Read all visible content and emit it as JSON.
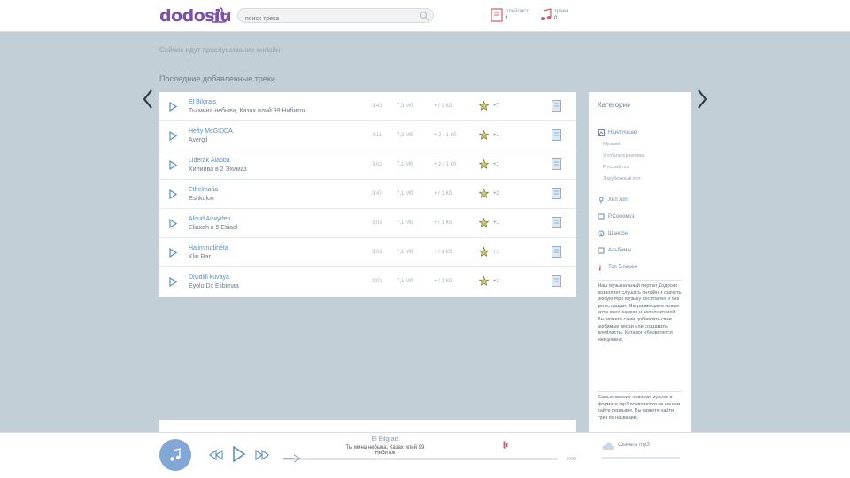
{
  "header": {
    "logo": "dodosiu",
    "search_placeholder": "поиск трека",
    "playlist": {
      "label": "плейлист",
      "count": "1"
    },
    "tracks_counter": {
      "label": "треки",
      "count": "0"
    }
  },
  "ghost_line": "Сейчас идут прослушивание онлайн",
  "section_title": "Последние добавленные треки",
  "tracks": [
    {
      "title": "El Bilgrais",
      "artist": "Ты мина небыва, Казах илий 99 Нибиток",
      "duration": "3:41",
      "size": "7,3 Мб",
      "rate": "+ / 1 Кб",
      "votes": "+7"
    },
    {
      "title": "Hefty McGIDDA",
      "artist": "Avergil",
      "duration": "4:11",
      "size": "7,2 Мб",
      "rate": "+ 2 / 1 Кб",
      "votes": "+1"
    },
    {
      "title": "Liderák Álabba",
      "artist": "Хилиива в 2 Эхимаз",
      "duration": "3:02",
      "size": "7,1 Мб",
      "rate": "+ 2 / 1 Кб",
      "votes": "+1"
    },
    {
      "title": "Ethelmafia",
      "artist": "Eshkoloo",
      "duration": "3:47",
      "size": "7,1 Мб",
      "rate": "+ / 1 Кб",
      "votes": "+2"
    },
    {
      "title": "Aloud Ailwyden",
      "artist": "Eliaxah в 5 Etiiael",
      "duration": "3:01",
      "size": "7,1 Мб",
      "rate": "+ / 1 Кб",
      "votes": "+1"
    },
    {
      "title": "Halimirudinéta",
      "artist": "Klin Rar",
      "duration": "3:01",
      "size": "7,1 Мб",
      "rate": "+ / 1 Кб",
      "votes": "+1"
    },
    {
      "title": "Dividiill kúvaya",
      "artist": "Eyolo Dx Elibimaa",
      "duration": "3:01",
      "size": "7,1 Мб",
      "rate": "+ / 1 Кб",
      "votes": "+1"
    }
  ],
  "sidebar": {
    "title": "Категории",
    "genres_label": "Наилучшее",
    "sub_items": [
      "Музыки",
      "Хит/Альтернатива",
      "Русский поп",
      "Зарубежный поп"
    ],
    "links": [
      "Хип хоп",
      "Р.Союзмуз",
      "Шансон",
      "Альбомы",
      "Топ 5 песен"
    ],
    "about_text": "Наш музыкальный портал Додосио позволяет слушать онлайн и скачать любую mp3 музыку бесплатно и без регистрации. Мы размещаем новые хиты всех жанров и исполнителей. Вы можете сами добавлять свои любимые песни или создавать плейлисты. Каталог обновляется ежедневно.",
    "about_text2": "Самые свежие новинки музыки в формате mp3 появляются на нашем сайте первыми. Вы можете найти трек по названию."
  },
  "player": {
    "title": "El Bilgrais",
    "artist": "Ты мина небыва, Казах илий 99 Нибиток",
    "time": "0:00",
    "progress": 0.0,
    "cloud_label": "Скачать mp3"
  },
  "colors": {
    "background": "#c3cfd7",
    "accent": "#5b8fc0",
    "logo": "#7a4fb0",
    "player_avatar": "#82a7d4"
  },
  "icons": [
    "search-icon",
    "playlist-icon",
    "music-icon",
    "play-icon",
    "star-icon",
    "download-icon",
    "prev-icon",
    "next-icon",
    "cloud-icon",
    "volume-icon"
  ]
}
